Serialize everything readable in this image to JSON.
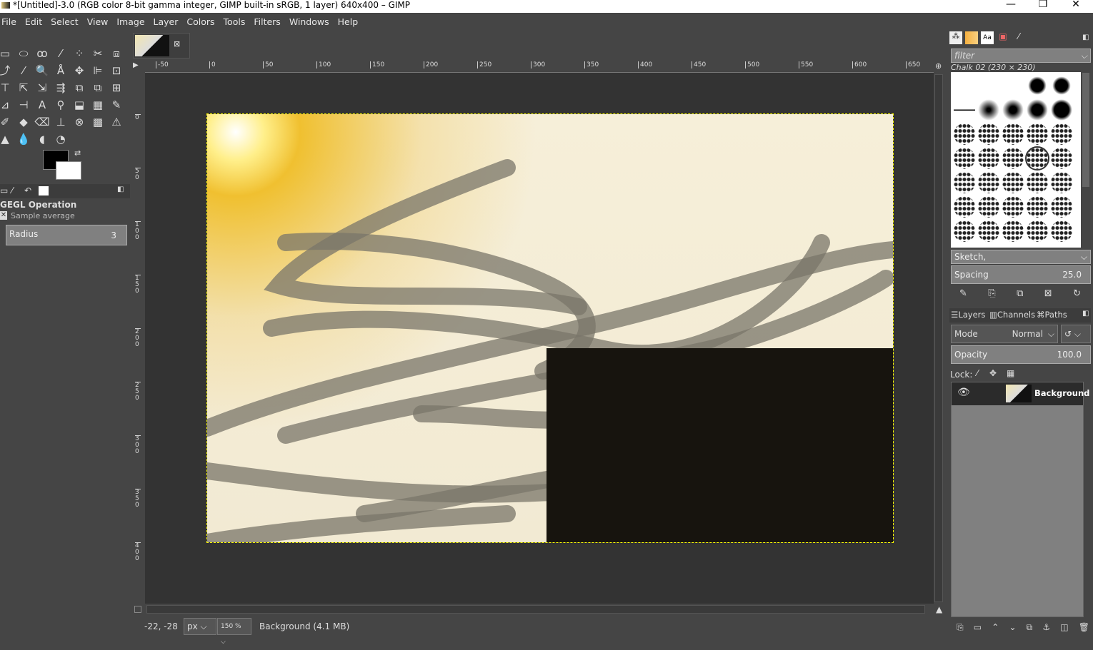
{
  "window": {
    "title": "*[Untitled]-3.0 (RGB color 8-bit gamma integer, GIMP built-in sRGB, 1 layer) 640x400 – GIMP",
    "minimize": "—",
    "maximize": "❐",
    "close": "✕"
  },
  "menu": [
    "File",
    "Edit",
    "Select",
    "View",
    "Image",
    "Layer",
    "Colors",
    "Tools",
    "Filters",
    "Windows",
    "Help"
  ],
  "tools": [
    "▭",
    "⬭",
    "ꝏ",
    "⁄",
    "⁘",
    "✂",
    "⧈",
    "⤴",
    "⁄",
    "🔍",
    "Å",
    "✥",
    "⊫",
    "⊡",
    "⊤",
    "⇱",
    "⇲",
    "⇶",
    "⧉",
    "⧉",
    "⊞",
    "⊿",
    "⊣",
    "A",
    "⚲",
    "⬓",
    "▦",
    "✎",
    "✐",
    "◆",
    "⌫",
    "⊥",
    "⊗",
    "▩",
    "⚠",
    "▲",
    "💧",
    "◖",
    "◔"
  ],
  "tool_options": {
    "title": "GEGL Operation",
    "sample_average": "Sample average",
    "radius_label": "Radius",
    "radius_value": "3"
  },
  "canvas": {
    "h_ruler": [
      "-50",
      "0",
      "50",
      "100",
      "150",
      "200",
      "250",
      "300",
      "350",
      "400",
      "450",
      "500",
      "550",
      "600",
      "650"
    ],
    "v_ruler": [
      "0",
      "50",
      "100",
      "150",
      "200",
      "250",
      "300",
      "350",
      "400"
    ]
  },
  "status": {
    "coords": "-22, -28",
    "unit": "px",
    "zoom": "150 %",
    "layer_info": "Background (4.1 MB)"
  },
  "brushes": {
    "filter_placeholder": "filter",
    "selected": "Chalk 02 (230 × 230)",
    "tag": "Sketch,",
    "spacing_label": "Spacing",
    "spacing_value": "25.0"
  },
  "layers": {
    "tabs": [
      "Layers",
      "Channels",
      "Paths"
    ],
    "mode_label": "Mode",
    "mode_value": "Normal",
    "opacity_label": "Opacity",
    "opacity_value": "100.0",
    "lock_label": "Lock:",
    "items": [
      {
        "name": "Background",
        "visible": true
      }
    ]
  }
}
